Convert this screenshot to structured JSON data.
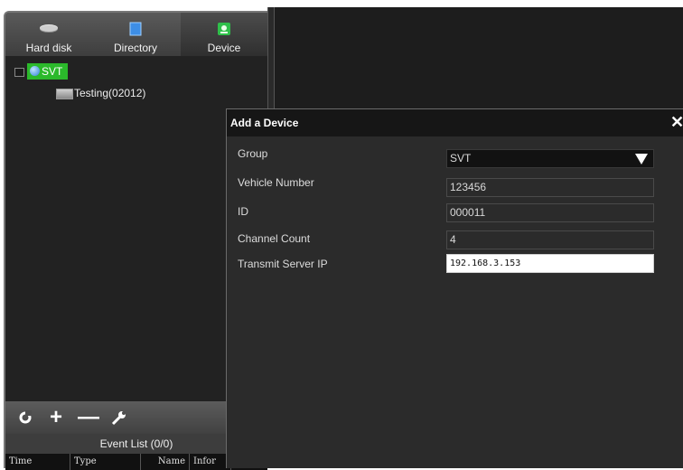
{
  "tabs": [
    {
      "label": "Hard disk",
      "icon": "hard-disk-icon"
    },
    {
      "label": "Directory",
      "icon": "directory-icon"
    },
    {
      "label": "Device",
      "icon": "device-icon"
    }
  ],
  "tree": {
    "group": "SVT",
    "device": "Testing(02012)"
  },
  "toolbar": {
    "refresh_icon": "refresh-icon",
    "add": "+",
    "remove": "—",
    "settings_icon": "wrench-icon"
  },
  "event_list": {
    "title": "Event List (0/0)",
    "columns": [
      "Time",
      "Type",
      "Name",
      "Infor"
    ]
  },
  "dialog": {
    "title": "Add a Device",
    "close": "✕",
    "fields": [
      {
        "label": "Group",
        "value": "SVT"
      },
      {
        "label": "Vehicle Number",
        "value": "123456"
      },
      {
        "label": "ID",
        "value": "000011"
      },
      {
        "label": "Channel Count",
        "value": "4"
      },
      {
        "label": "Transmit Server IP",
        "value": "192.168.3.153"
      }
    ]
  }
}
